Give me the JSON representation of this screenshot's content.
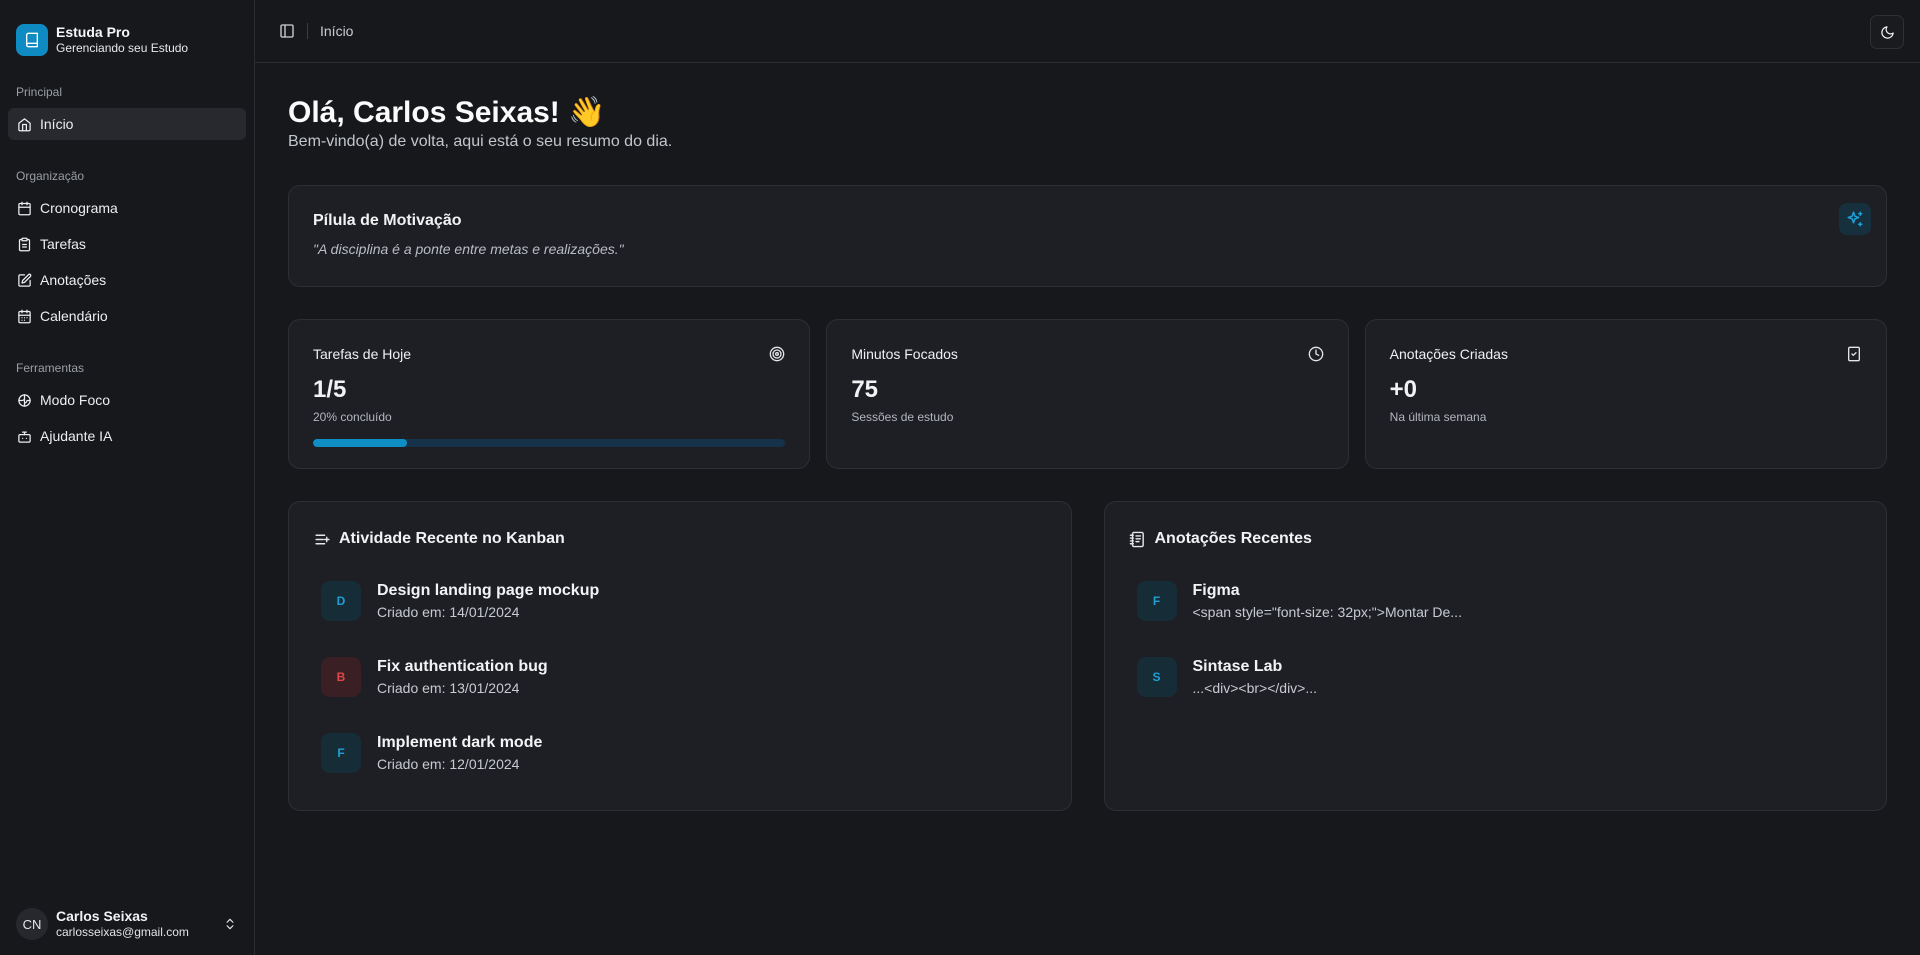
{
  "brand": {
    "name": "Estuda Pro",
    "subtitle": "Gerenciando seu Estudo",
    "logo_icon": "book-icon",
    "color": "#0e8bc2"
  },
  "sidebar": {
    "groups": [
      {
        "label": "Principal",
        "items": [
          {
            "label": "Início",
            "icon": "home-icon",
            "active": true
          }
        ]
      },
      {
        "label": "Organização",
        "items": [
          {
            "label": "Cronograma",
            "icon": "calendar-icon"
          },
          {
            "label": "Tarefas",
            "icon": "clipboard-icon"
          },
          {
            "label": "Anotações",
            "icon": "edit-note-icon"
          },
          {
            "label": "Calendário",
            "icon": "calendar-days-icon"
          }
        ]
      },
      {
        "label": "Ferramentas",
        "items": [
          {
            "label": "Modo Foco",
            "icon": "brain-icon"
          },
          {
            "label": "Ajudante IA",
            "icon": "bot-icon"
          }
        ]
      }
    ]
  },
  "user": {
    "initials": "CN",
    "name": "Carlos Seixas",
    "email": "carlosseixas@gmail.com"
  },
  "topbar": {
    "breadcrumb": "Início"
  },
  "page": {
    "greeting": "Olá, Carlos Seixas! 👋",
    "subtitle": "Bem-vindo(a) de volta, aqui está o seu resumo do dia."
  },
  "motivation": {
    "title": "Pílula de Motivação",
    "quote": "\"A disciplina é a ponte entre metas e realizações.\""
  },
  "stats": {
    "tasks": {
      "label": "Tarefas de Hoje",
      "value": "1/5",
      "note": "20% concluído",
      "progress": 0.2
    },
    "minutes": {
      "label": "Minutos Focados",
      "value": "75",
      "note": "Sessões de estudo"
    },
    "notes": {
      "label": "Anotações Criadas",
      "value": "+0",
      "note": "Na última semana"
    }
  },
  "kanban": {
    "title": "Atividade Recente no Kanban",
    "items": [
      {
        "badge": "D",
        "title": "Design landing page mockup",
        "sub": "Criado em: 14/01/2024",
        "color": "#1f9fd4"
      },
      {
        "badge": "B",
        "title": "Fix authentication bug",
        "sub": "Criado em: 13/01/2024",
        "color": "#e04848"
      },
      {
        "badge": "F",
        "title": "Implement dark mode",
        "sub": "Criado em: 12/01/2024",
        "color": "#1f9fd4"
      }
    ]
  },
  "recent_notes": {
    "title": "Anotações Recentes",
    "items": [
      {
        "badge": "F",
        "title": "Figma",
        "sub": "<span style=\"font-size: 32px;\">Montar De..."
      },
      {
        "badge": "S",
        "title": "Sintase Lab",
        "sub": "...<div><br></div>..."
      }
    ]
  }
}
